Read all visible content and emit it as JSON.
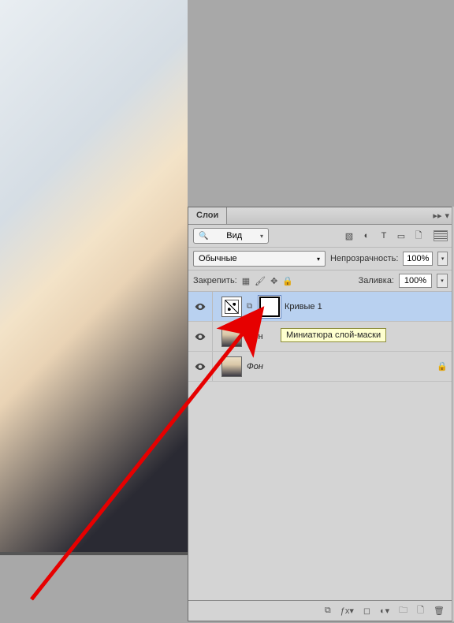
{
  "panel": {
    "tab_label": "Слои",
    "filter_label": "Вид",
    "blend_mode": "Обычные",
    "opacity_label": "Непрозрачность:",
    "opacity_value": "100%",
    "fill_label": "Заливка:",
    "fill_value": "100%",
    "lock_label": "Закрепить:"
  },
  "layers": [
    {
      "name": "Кривые 1",
      "type": "adjustment"
    },
    {
      "name": "Фон",
      "type": "image"
    },
    {
      "name": "Фон",
      "type": "image_locked"
    }
  ],
  "tooltip": "Миниатюра слой-маски"
}
